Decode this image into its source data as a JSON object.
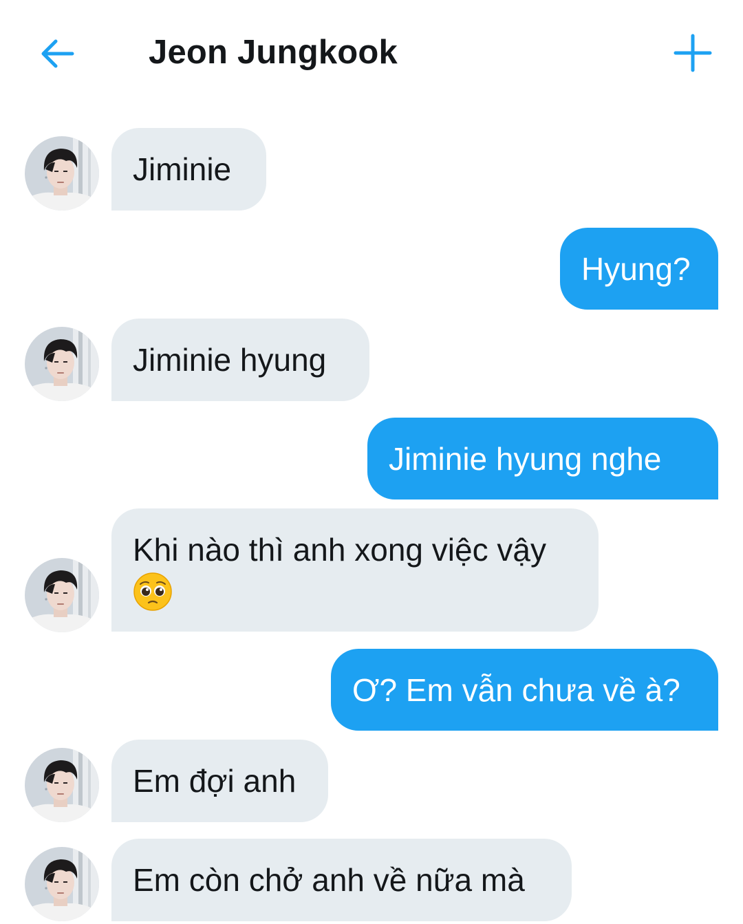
{
  "header": {
    "title": "Jeon Jungkook",
    "back_icon": "arrow-left-icon",
    "add_icon": "plus-icon",
    "accent_color": "#1da1f2"
  },
  "messages": [
    {
      "sender": "contact",
      "text": "Jiminie"
    },
    {
      "sender": "me",
      "text": "Hyung?"
    },
    {
      "sender": "contact",
      "text": "Jiminie hyung"
    },
    {
      "sender": "me",
      "text": "Jiminie hyung nghe"
    },
    {
      "sender": "contact",
      "text": "Khi nào thì anh xong việc vậy",
      "emoji": "pleading-face-emoji"
    },
    {
      "sender": "me",
      "text": "Ơ? Em vẫn chưa về à?"
    },
    {
      "sender": "contact",
      "text": "Em đợi anh"
    },
    {
      "sender": "contact",
      "text": "Em còn chở anh về nữa mà"
    }
  ],
  "colors": {
    "incoming_bubble": "#e6ecf0",
    "outgoing_bubble": "#1da1f2",
    "text_dark": "#14171a"
  }
}
